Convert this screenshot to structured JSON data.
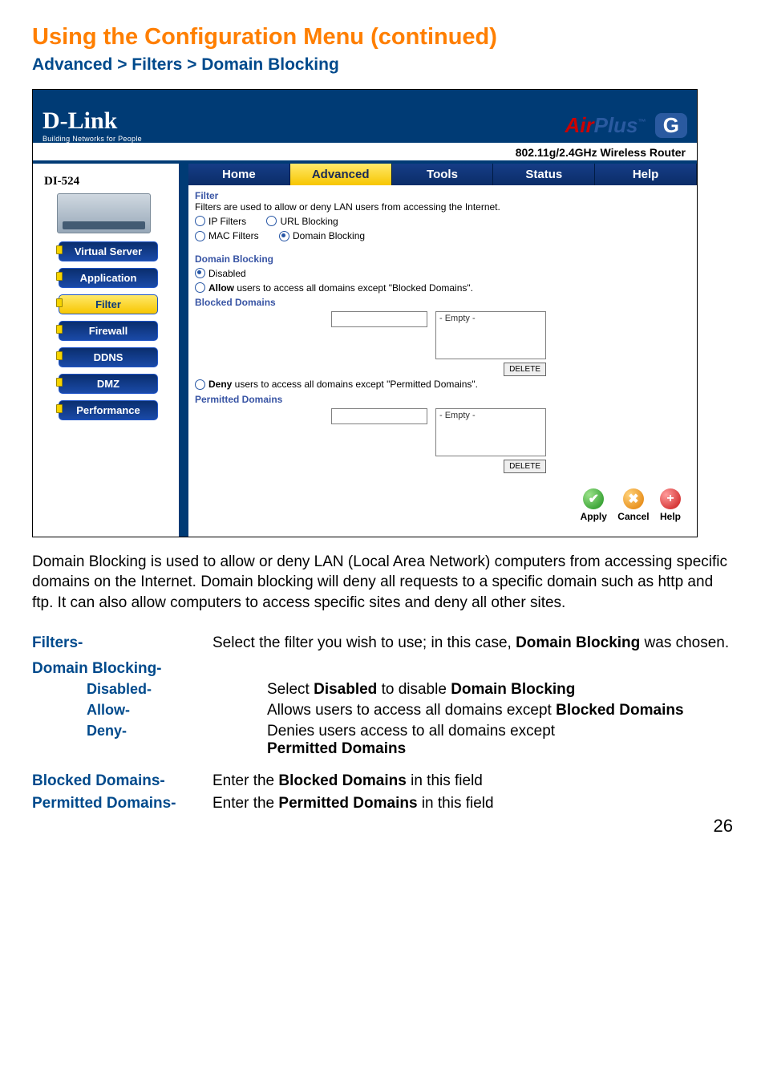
{
  "page": {
    "title": "Using the Configuration Menu  (continued)",
    "breadcrumb": "Advanced > Filters > Domain Blocking",
    "number": "26"
  },
  "router": {
    "brand": "D-Link",
    "brand_tag": "Building Networks for People",
    "product_line_air": "Air",
    "product_line_plus": "Plus",
    "product_line_tm": "™",
    "product_line_g": "G",
    "band": "802.11g/2.4GHz Wireless Router",
    "model": "DI-524",
    "sidebar": [
      {
        "label": "Virtual Server",
        "active": false
      },
      {
        "label": "Application",
        "active": false
      },
      {
        "label": "Filter",
        "active": true
      },
      {
        "label": "Firewall",
        "active": false
      },
      {
        "label": "DDNS",
        "active": false
      },
      {
        "label": "DMZ",
        "active": false
      },
      {
        "label": "Performance",
        "active": false
      }
    ],
    "tabs": [
      {
        "label": "Home",
        "active": false
      },
      {
        "label": "Advanced",
        "active": true
      },
      {
        "label": "Tools",
        "active": false
      },
      {
        "label": "Status",
        "active": false
      },
      {
        "label": "Help",
        "active": false
      }
    ],
    "filter": {
      "heading": "Filter",
      "desc": "Filters are used to allow or deny LAN users from accessing the Internet.",
      "options": {
        "ip": "IP Filters",
        "url": "URL Blocking",
        "mac": "MAC Filters",
        "domain": "Domain Blocking"
      },
      "selected": "domain"
    },
    "domain_blocking": {
      "heading": "Domain Blocking",
      "disabled": "Disabled",
      "allow_pre": "Allow",
      "allow_rest": " users to access all domains except \"Blocked Domains\".",
      "deny_pre": "Deny",
      "deny_rest": " users to access all domains except \"Permitted Domains\".",
      "blocked_heading": "Blocked Domains",
      "permitted_heading": "Permitted Domains",
      "empty": "- Empty -",
      "delete": "DELETE"
    },
    "actions": {
      "apply": "Apply",
      "cancel": "Cancel",
      "help": "Help"
    }
  },
  "description": "Domain Blocking is used to allow or deny LAN (Local Area Network) computers from accessing specific domains on the Internet. Domain blocking will deny all requests to a specific domain such as http and ftp. It can also allow computers to access specific sites and deny all other sites.",
  "definitions": {
    "filters_label": "Filters-",
    "filters_text_1": "Select the filter you wish to use; in this case, ",
    "filters_text_bold": "Domain Blocking",
    "filters_text_2": " was chosen.",
    "db_label": "Domain Blocking-",
    "disabled_label": "Disabled-",
    "disabled_1": "Select ",
    "disabled_b1": "Disabled",
    "disabled_2": " to disable ",
    "disabled_b2": "Domain Blocking",
    "allow_label": "Allow-",
    "allow_1": "Allows users to access all domains except ",
    "allow_b": "Blocked Domains",
    "deny_label": "Deny-",
    "deny_1": "Denies users  access to  all domains except ",
    "deny_b": "Permitted Domains",
    "bd_label": "Blocked Domains-",
    "bd_1": "Enter the ",
    "bd_b": "Blocked Domains",
    "bd_2": " in this field",
    "pd_label": "Permitted Domains-",
    "pd_1": "Enter the ",
    "pd_b": "Permitted Domains",
    "pd_2": " in this field"
  }
}
